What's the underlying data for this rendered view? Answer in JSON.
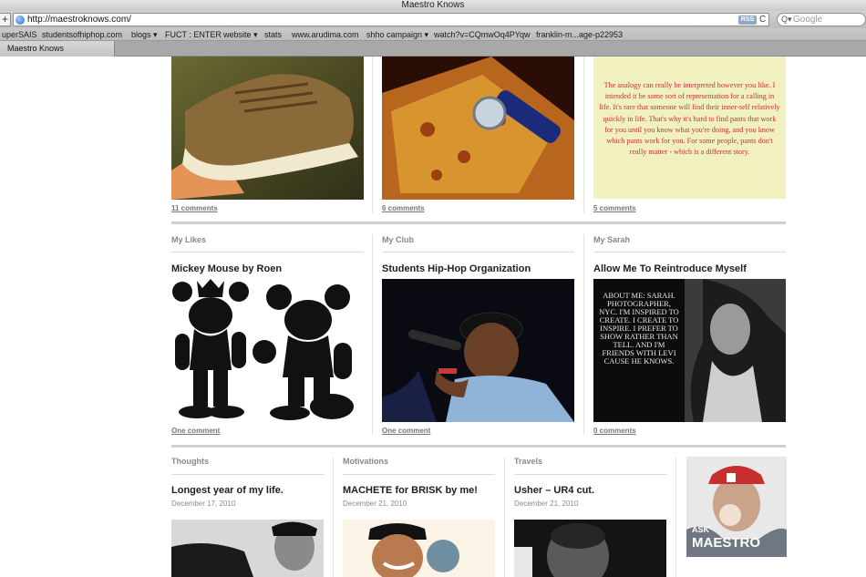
{
  "window": {
    "title": "Maestro Knows"
  },
  "toolbar": {
    "add_label": "+",
    "url": "http://maestroknows.com/",
    "rss_label": "RSS",
    "reload_glyph": "C",
    "search_placeholder": "Google",
    "search_glyph": "Q▾"
  },
  "bookmarks": [
    "uperSAIS",
    "studentsofhiphop.com",
    "blogs ▾",
    "FUCT : ENTER",
    "website ▾",
    "stats",
    "www.arudima.com",
    "shho campaign ▾",
    "watch?v=CQmwOq4PYqw",
    "franklin-m...age-p22953"
  ],
  "tabs": [
    {
      "label": "Maestro Knows"
    }
  ],
  "row1": {
    "comments": [
      "11 comments",
      "6 comments",
      "5 comments"
    ],
    "quote": "The analogy can really be interpreted however you like. I intended it be some sort of representation for a calling in life. It's rare that someone will find their inner-self relatively quickly in life. That's why it's hard to find pants that work for you until you know what you're doing, and you know which pants work for you. For some people, pants don't really matter - which is a different story."
  },
  "row2": [
    {
      "section": "My Likes",
      "title": "Mickey Mouse by Roen",
      "comments": "One comment"
    },
    {
      "section": "My Club",
      "title": "Students Hip-Hop Organization",
      "comments": "One comment"
    },
    {
      "section": "My Sarah",
      "title": "Allow Me To Reintroduce Myself",
      "comments": "0 comments",
      "image_text": "ABOUT ME: SARAH. PHOTOGRAPHER, NYC. I'M INSPIRED TO CREATE. I CREATE TO INSPIRE. I PREFER TO SHOW RATHER THAN TELL. AND I'M FRIENDS WITH LEVI CAUSE HE KNOWS."
    }
  ],
  "row3": [
    {
      "section": "Thoughts",
      "title": "Longest year of my life.",
      "date": "December 17, 2010"
    },
    {
      "section": "Motivations",
      "title": "MACHETE for BRISK by me!",
      "date": "December 21, 2010"
    },
    {
      "section": "Travels",
      "title": "Usher – UR4 cut.",
      "date": "December 21, 2010"
    }
  ],
  "ask_maestro": {
    "line1": "ASK",
    "line2": "MAESTRO"
  }
}
